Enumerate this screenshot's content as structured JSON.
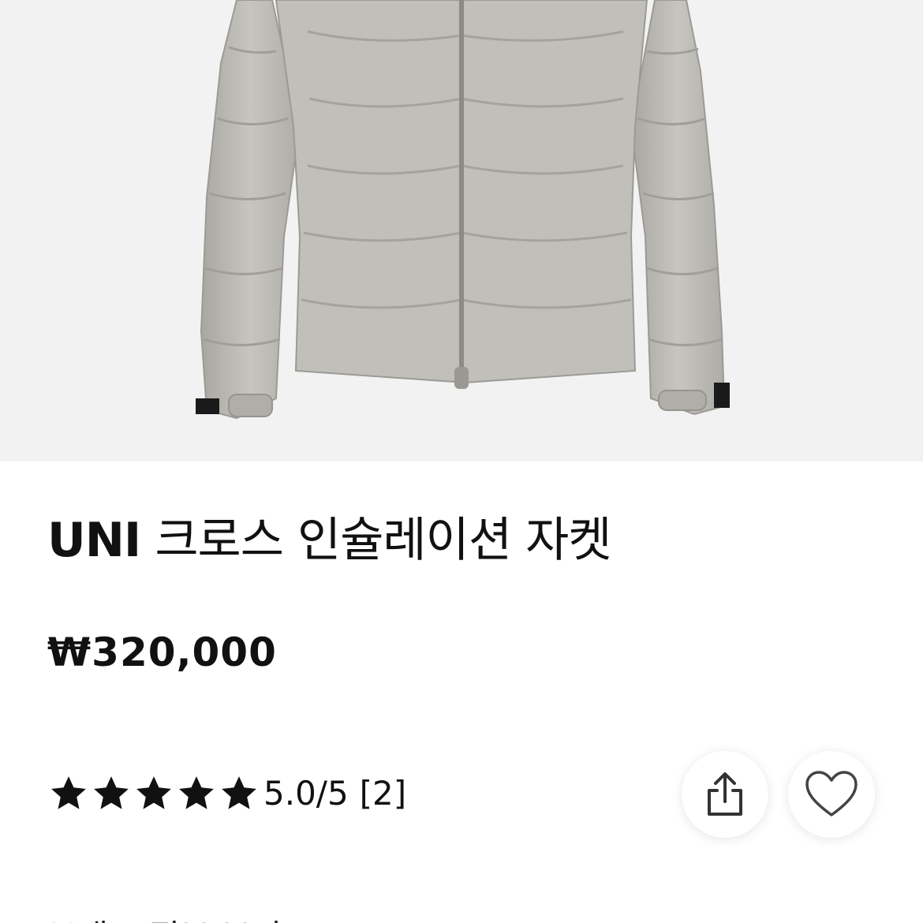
{
  "product": {
    "brand": "UNI",
    "name": "크로스 인슐레이션 자켓",
    "price": "₩320,000",
    "rating": {
      "score_text": "5.0/5",
      "count_text": "[2]",
      "stars": 5
    }
  },
  "icons": {
    "star": "star-icon",
    "share": "share-icon",
    "like": "heart-icon"
  },
  "colors": {
    "hero_background": "#f2f2f2",
    "jacket": "#bdbbb5",
    "text": "#111111"
  },
  "bottom": {
    "partial_text": "브랜드 정보 보기"
  }
}
